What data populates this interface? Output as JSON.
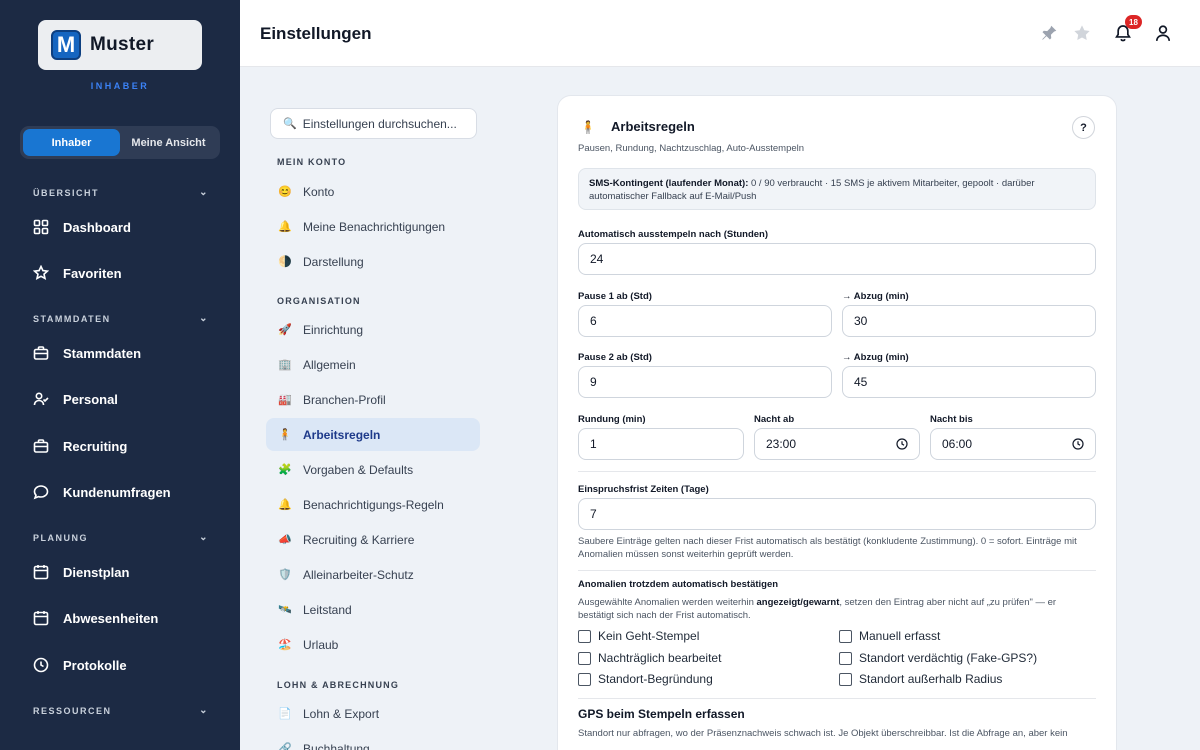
{
  "sidebar": {
    "logo_letter": "M",
    "logo_text": "Muster",
    "role": "INHABER",
    "toggle": [
      "Inhaber",
      "Meine Ansicht"
    ],
    "sections": {
      "uebersicht": "ÜBERSICHT",
      "stammdaten": "STAMMDATEN",
      "planung": "PLANUNG",
      "ressourcen": "RESSOURCEN"
    },
    "items": {
      "dashboard": "Dashboard",
      "favoriten": "Favoriten",
      "stammdaten": "Stammdaten",
      "personal": "Personal",
      "recruiting": "Recruiting",
      "kundenumfragen": "Kundenumfragen",
      "dienstplan": "Dienstplan",
      "abwesenheiten": "Abwesenheiten",
      "protokolle": "Protokolle"
    }
  },
  "header": {
    "title": "Einstellungen",
    "notification_count": "18"
  },
  "settings_nav": {
    "search_placeholder": "Einstellungen durchsuchen...",
    "sections": {
      "mein_konto": "MEIN KONTO",
      "organisation": "ORGANISATION",
      "lohn": "LOHN & ABRECHNUNG"
    },
    "items": {
      "konto": "Konto",
      "benachrichtigungen": "Meine Benachrichtigungen",
      "darstellung": "Darstellung",
      "einrichtung": "Einrichtung",
      "allgemein": "Allgemein",
      "branchen": "Branchen-Profil",
      "arbeitsregeln": "Arbeitsregeln",
      "vorgaben": "Vorgaben & Defaults",
      "benach_regeln": "Benachrichtigungs-Regeln",
      "recruiting": "Recruiting & Karriere",
      "alleinarbeiter": "Alleinarbeiter-Schutz",
      "leitstand": "Leitstand",
      "urlaub": "Urlaub",
      "lohn_export": "Lohn & Export",
      "buchhaltung": "Buchhaltung"
    }
  },
  "card": {
    "title": "Arbeitsregeln",
    "subtitle": "Pausen, Rundung, Nachtzuschlag, Auto-Ausstempeln",
    "help": "?",
    "sms_label": "SMS-Kontingent (laufender Monat):",
    "sms_text": " 0 / 90 verbraucht · 15 SMS je aktivem Mitarbeiter, gepoolt · darüber automatischer Fallback auf E-Mail/Push",
    "fields": {
      "auto_out_label": "Automatisch ausstempeln nach (Stunden)",
      "auto_out_value": "24",
      "pause1_label": "Pause 1 ab (Std)",
      "pause1_value": "6",
      "abzug1_label": "→ Abzug (min)",
      "abzug1_value": "30",
      "pause2_label": "Pause 2 ab (Std)",
      "pause2_value": "9",
      "abzug2_label": "→ Abzug (min)",
      "abzug2_value": "45",
      "rundung_label": "Rundung (min)",
      "rundung_value": "1",
      "nacht_ab_label": "Nacht ab",
      "nacht_ab_value": "23:00",
      "nacht_bis_label": "Nacht bis",
      "nacht_bis_value": "06:00",
      "frist_label": "Einspruchsfrist Zeiten (Tage)",
      "frist_value": "7"
    },
    "frist_hint": "Saubere Einträge gelten nach dieser Frist automatisch als bestätigt (konkludente Zustimmung). 0 = sofort. Einträge mit Anomalien müssen sonst weiterhin geprüft werden.",
    "anomalien_title": "Anomalien trotzdem automatisch bestätigen",
    "anomalien_hint_a": "Ausgewählte Anomalien werden weiterhin ",
    "anomalien_hint_b": "angezeigt/gewarnt",
    "anomalien_hint_c": ", setzen den Eintrag aber nicht auf „zu prüfen\" — er bestätigt sich nach der Frist automatisch.",
    "checkboxes": {
      "kein_geht": "Kein Geht-Stempel",
      "manuell": "Manuell erfasst",
      "nachtraeglich": "Nachträglich bearbeitet",
      "fake_gps": "Standort verdächtig (Fake-GPS?)",
      "begruendung": "Standort-Begründung",
      "radius": "Standort außerhalb Radius"
    },
    "gps_title": "GPS beim Stempeln erfassen",
    "gps_text": "Standort nur abfragen, wo der Präsenznachweis schwach ist. Je Objekt überschreibbar. Ist die Abfrage an, aber kein"
  }
}
